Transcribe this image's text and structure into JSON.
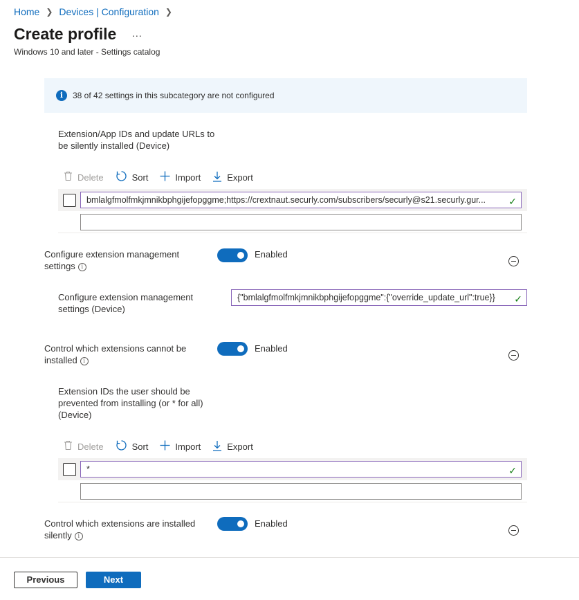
{
  "breadcrumb": [
    "Home",
    "Devices | Configuration"
  ],
  "header": {
    "title": "Create profile",
    "more_label": "...",
    "subtitle": "Windows 10 and later - Settings catalog"
  },
  "info_bar": {
    "text": "38 of 42 settings in this subcategory are not configured"
  },
  "toolbar": {
    "delete": "Delete",
    "sort": "Sort",
    "import": "Import",
    "export": "Export"
  },
  "section1": {
    "label_line1": "Extension/App IDs and update URLs to",
    "label_line2": "be silently installed (Device)",
    "value": "bmlalgfmolfmkjmnikbphgijefopggme;https://crextnaut.securly.com/subscribers/securly@s21.securly.gur...",
    "empty_value": ""
  },
  "setting_ext_mgmt": {
    "label_line1": "Configure extension management",
    "label_line2": "settings",
    "toggle": "Enabled",
    "child_label_line1": "Configure extension management",
    "child_label_line2": "settings (Device)",
    "child_value": "{\"bmlalgfmolfmkjmnikbphgijefopggme\":{\"override_update_url\":true}}"
  },
  "setting_blocklist": {
    "label_line1": "Control which extensions cannot be",
    "label_line2": "installed",
    "toggle": "Enabled",
    "child_label_line1": "Extension IDs the user should be",
    "child_label_line2": "prevented from installing (or * for all)",
    "child_label_line3": "(Device)",
    "value": "*",
    "empty_value": ""
  },
  "setting_forcelist": {
    "label_line1": "Control which extensions are installed",
    "label_line2": "silently",
    "toggle": "Enabled"
  },
  "footer": {
    "previous": "Previous",
    "next": "Next"
  },
  "colors": {
    "accent": "#0f6cbd",
    "info_bg": "#eff6fc",
    "valid_border": "#8764b8",
    "check": "#107c10"
  }
}
